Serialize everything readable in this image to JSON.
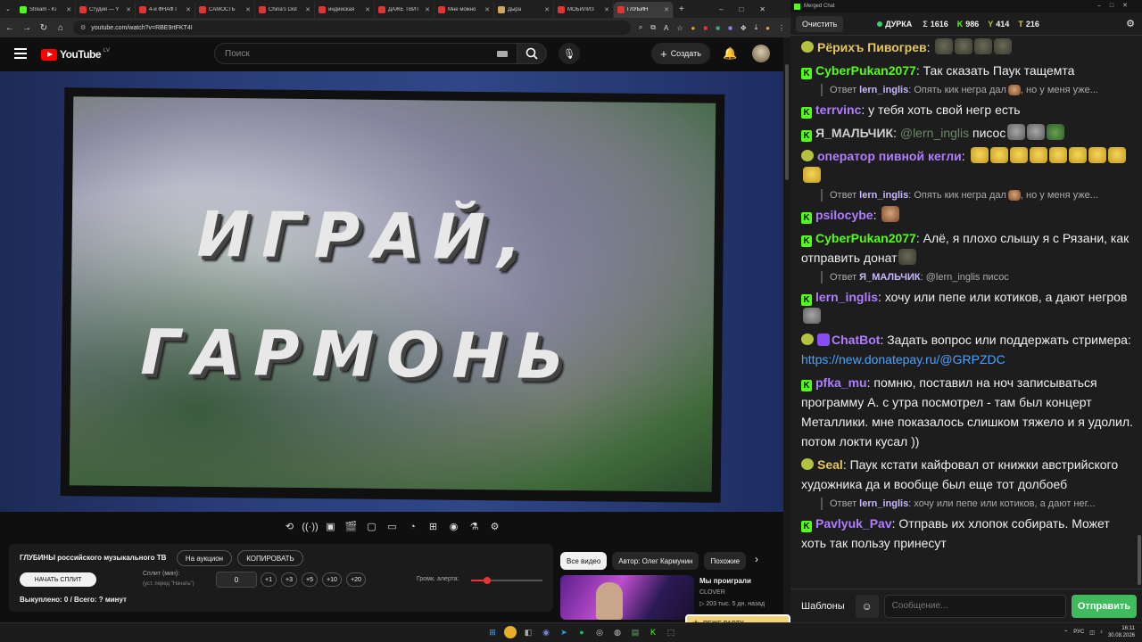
{
  "browser": {
    "tabs": [
      {
        "label": "Stream - Ki",
        "color": "#53fc18",
        "active": false
      },
      {
        "label": "Студия — Y",
        "color": "#e33333",
        "active": false
      },
      {
        "label": "4-й ФНАФ Г",
        "color": "#e33333",
        "active": false
      },
      {
        "label": "САМОСТЬ",
        "color": "#e33333",
        "active": false
      },
      {
        "label": "China's Dist",
        "color": "#e33333",
        "active": false
      },
      {
        "label": "индийская",
        "color": "#e33333",
        "active": false
      },
      {
        "label": "ДАЖЕ ТВИТ",
        "color": "#e33333",
        "active": false
      },
      {
        "label": "Мне можно",
        "color": "#e33333",
        "active": false
      },
      {
        "label": "Дыра",
        "color": "#cfa55a",
        "active": false
      },
      {
        "label": "МОБИЛИЗ",
        "color": "#e33333",
        "active": false
      },
      {
        "label": "ГЛУБИН",
        "color": "#e33333",
        "active": true
      }
    ],
    "url": "youtube.com/watch?v=RBE9rtFKT4I"
  },
  "youtube": {
    "logo_text": "YouTube",
    "region": "LV",
    "search_placeholder": "Поиск",
    "create_label": "Создать"
  },
  "video": {
    "title_line1": "ИГРАЙ,",
    "title_line2": "ГАРМОНЬ"
  },
  "panel": {
    "title": "ГЛУБИНЫ российского музыкального ТВ",
    "auction_label": "На аукцион",
    "copy_label": "КОПИРОВАТЬ",
    "split_button": "НАЧАТЬ СПЛИТ",
    "split_label": "Сплит (мин):",
    "split_hint": "(уст. перед \"Начать\")",
    "split_value": "0",
    "increments": [
      "+1",
      "+3",
      "+5",
      "+10",
      "+20"
    ],
    "alert_label": "Громк. алерта:",
    "alert_level": 0.22,
    "bought_text": "Выкуплено: 0 / Всего: ? минут"
  },
  "chips": [
    "Все видео",
    "Автор: Олег Кармунин",
    "Похожие"
  ],
  "related": {
    "title": "Мы проиграли",
    "channel": "CLOVER",
    "meta": "▷ 203 тыс.   5 дн. назад"
  },
  "overlay": {
    "party_label": "ПЕЖЕ PARTY"
  },
  "taskbar": {
    "lang": "РУС",
    "time": "16:11",
    "date": "30.08.2026"
  },
  "chat": {
    "window_title": "Merged Chat",
    "clear_label": "Очистить",
    "channel_name": "ДУРКА",
    "stats": [
      {
        "icon": "Σ",
        "value": "1616"
      },
      {
        "icon": "K",
        "value": "986"
      },
      {
        "icon": "Y",
        "value": "414"
      },
      {
        "icon": "T",
        "value": "216"
      }
    ],
    "messages": [
      {
        "type": "msg",
        "platform": "y",
        "name": "Рёрихъ Пивогрев",
        "color": "gold",
        "text": "",
        "emotes": [
          "frog",
          "frog",
          "frog",
          "frog"
        ]
      },
      {
        "type": "msg",
        "platform": "k",
        "name": "CyberPukan2077",
        "color": "green",
        "text": "Так сказать Паук тащемта",
        "emotes": []
      },
      {
        "type": "reply",
        "label": "Ответ",
        "name": "lern_inglis",
        "text": "Опять кик негра дал",
        "tail": ", но у меня уже..."
      },
      {
        "type": "msg",
        "platform": "k",
        "name": "terrvinc",
        "color": "purple",
        "text": "у тебя хоть свой негр есть",
        "emotes": []
      },
      {
        "type": "msg",
        "platform": "k",
        "name": "Я_МАЛЬЧИК",
        "color": "gray",
        "mention": "@lern_inglis",
        "text": "писос",
        "emotes": [
          "cat",
          "cat",
          "plant"
        ]
      },
      {
        "type": "msg",
        "platform": "y",
        "name": "оператор пивной кегли",
        "color": "purple",
        "text": "",
        "emotes": [
          "laugh",
          "laugh",
          "laugh",
          "laugh",
          "laugh",
          "laugh",
          "laugh",
          "laugh",
          "laugh"
        ]
      },
      {
        "type": "reply",
        "label": "Ответ",
        "name": "lern_inglis",
        "text": "Опять кик негра дал",
        "tail": ", но у меня уже..."
      },
      {
        "type": "msg",
        "platform": "k",
        "name": "psilocybe",
        "color": "purple",
        "text": "",
        "emotes": [
          "face"
        ]
      },
      {
        "type": "msg",
        "platform": "k",
        "name": "CyberPukan2077",
        "color": "green",
        "text": "Алё, я плохо слышу я с Рязани, как отправить донат",
        "emotes": [
          "frog"
        ]
      },
      {
        "type": "reply",
        "label": "Ответ",
        "name": "Я_МАЛЬЧИК",
        "text": "@lern_inglis писос",
        "tail": ""
      },
      {
        "type": "msg",
        "platform": "k",
        "name": "lern_inglis",
        "color": "purple",
        "text": "хочу или пепе или котиков, а дают негров",
        "emotes": [
          "cat"
        ]
      },
      {
        "type": "msg",
        "platform": "y",
        "name": "ChatBot",
        "color": "purple",
        "bot": true,
        "text": "Задать вопрос или поддержать стримера:",
        "link": "https://new.donatepay.ru/@GRPZDC",
        "emotes": []
      },
      {
        "type": "msg",
        "platform": "k",
        "name": "pfka_mu",
        "color": "purple",
        "text": "помню, поставил на ноч записываться программу А. с утра посмотрел - там был концерт Металлики. мне показалось слишком тяжело и я удолил. потом локти кусал ))",
        "emotes": []
      },
      {
        "type": "msg",
        "platform": "y",
        "name": "Seal",
        "color": "gold",
        "text": "Паук кстати кайфовал от книжки австрийского художника да и вообще был еще тот долбоеб",
        "emotes": []
      },
      {
        "type": "reply",
        "label": "Ответ",
        "name": "lern_inglis",
        "text": "хочу или пепе или котиков, а дают нег...",
        "tail": ""
      },
      {
        "type": "msg",
        "platform": "k",
        "name": "Pavlyuk_Pav",
        "color": "purple",
        "text": "Отправь их хлопок собирать. Может хоть так пользу принесут",
        "emotes": []
      }
    ],
    "templates_label": "Шаблоны",
    "message_placeholder": "Сообщение...",
    "send_label": "Отправить"
  }
}
